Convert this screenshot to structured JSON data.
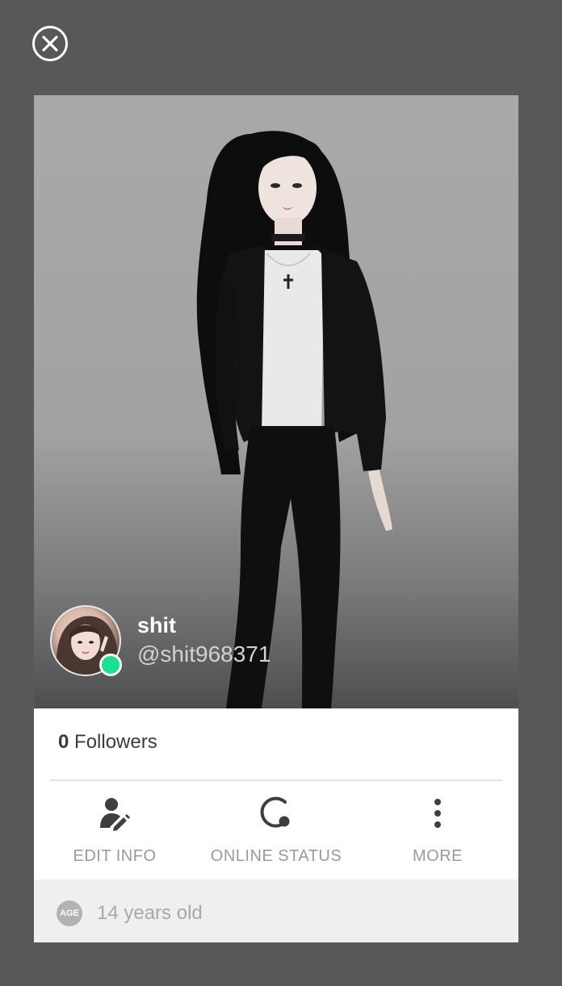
{
  "profile": {
    "display_name": "shit",
    "username": "@shit968371",
    "online": true,
    "online_color": "#19e28f"
  },
  "stats": {
    "followers_count": "0",
    "followers_label": "Followers"
  },
  "actions": [
    {
      "label": "EDIT INFO",
      "icon": "edit-person-icon"
    },
    {
      "label": "ONLINE STATUS",
      "icon": "online-status-icon"
    },
    {
      "label": "MORE",
      "icon": "more-vertical-icon"
    }
  ],
  "age": {
    "badge": "AGE",
    "text": "14 years old"
  },
  "icons": {
    "close": "close-icon"
  }
}
